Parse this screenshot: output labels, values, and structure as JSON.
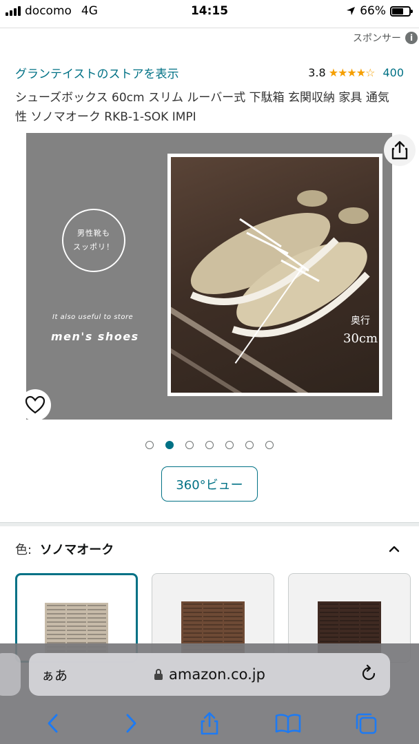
{
  "status_bar": {
    "carrier": "docomo",
    "network": "4G",
    "time": "14:15",
    "battery_percent": "66%",
    "battery_level": 0.66
  },
  "sponsor": {
    "label": "スポンサー",
    "icon": "info-icon"
  },
  "store": {
    "link_text": "グランテイストのストアを表示",
    "rating": "3.8",
    "rating_value": 3.8,
    "review_count": "400"
  },
  "product": {
    "title": "シューズボックス 60cm スリム ルーバー式 下駄箱 玄関収納 家具 通気性 ソノマオーク RKB-1-SOK IMPI"
  },
  "image": {
    "badge_line1": "男性靴も",
    "badge_line2": "スッポリ！",
    "caption_small": "It also useful to store",
    "caption_big": "men's shoes",
    "depth_label": "奥行",
    "depth_value": "30cm",
    "active_index": 1,
    "total": 7
  },
  "view360": {
    "label": "360°ビュー"
  },
  "color": {
    "label": "色:",
    "value": "ソノマオーク",
    "swatches": [
      {
        "name": "ソノマオーク",
        "color": "#c7bba9",
        "selected": true
      },
      {
        "name": "brown",
        "color": "#6e4a35",
        "selected": false
      },
      {
        "name": "dark-brown",
        "color": "#3f2a22",
        "selected": false
      }
    ]
  },
  "browser": {
    "aa": "ぁあ",
    "url": "amazon.co.jp"
  },
  "colors": {
    "link": "#007185",
    "star": "#f59f00",
    "ios_blue": "#1d7af3"
  }
}
